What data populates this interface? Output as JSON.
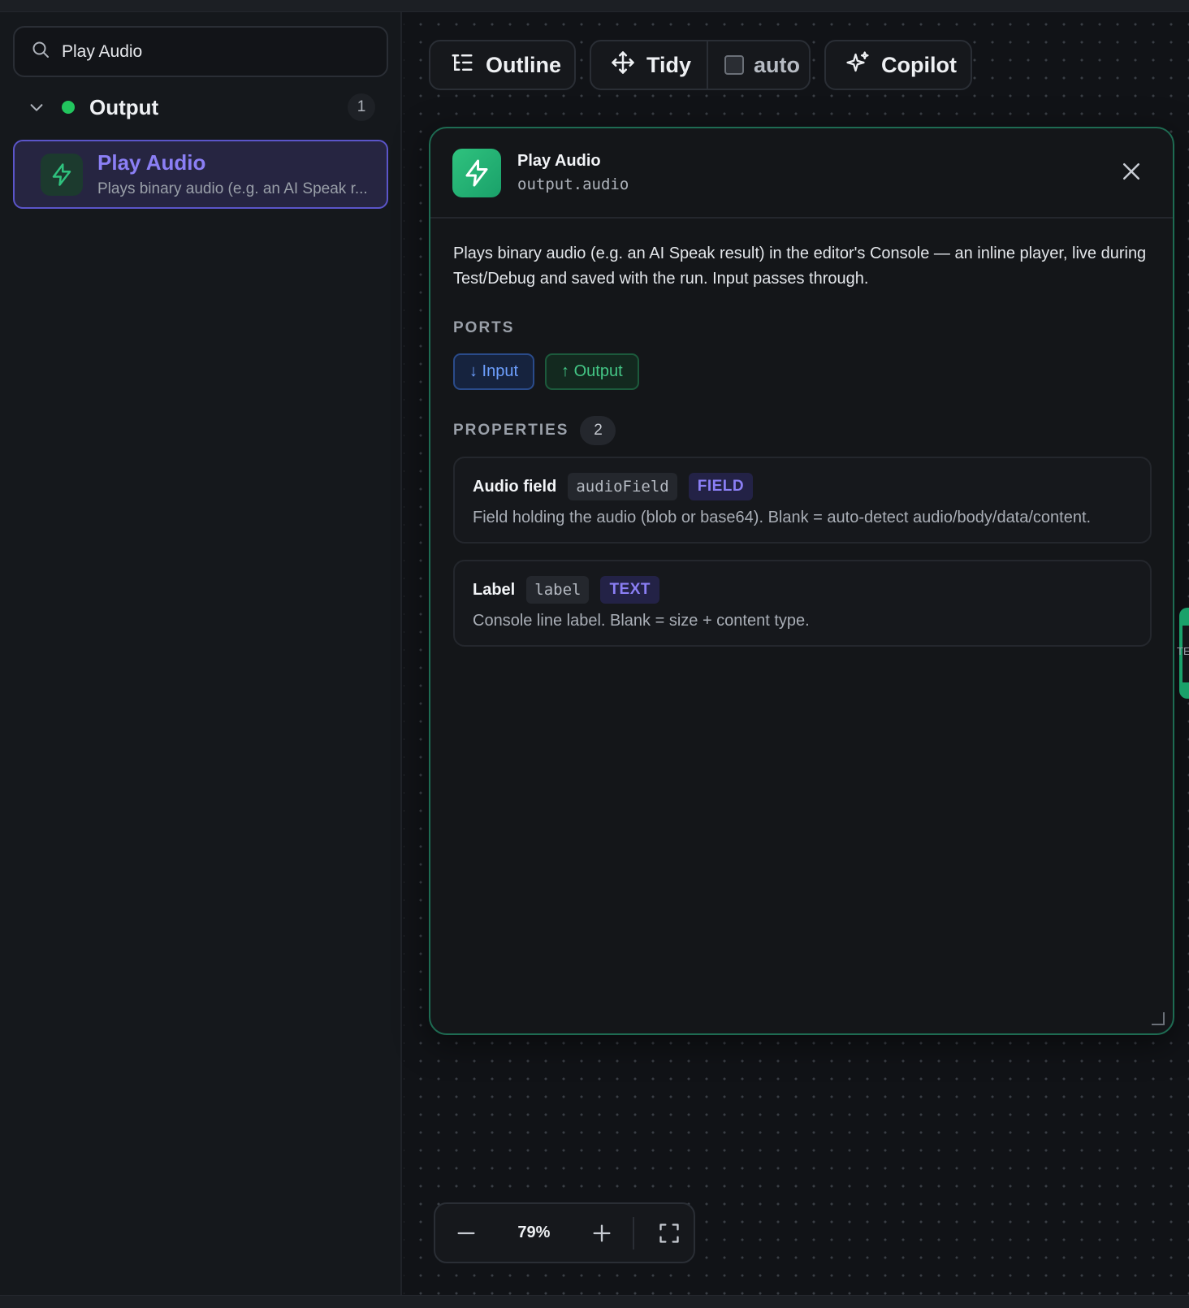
{
  "sidebar": {
    "search": {
      "value": "Play Audio",
      "icon": "search-icon"
    },
    "group": {
      "label": "Output",
      "count": "1",
      "status_color": "#22c55e"
    },
    "node": {
      "title": "Play Audio",
      "description": "Plays binary audio (e.g. an AI Speak r...",
      "icon": "bolt-icon"
    }
  },
  "toolbar": {
    "outline_label": "Outline",
    "tidy_label": "Tidy",
    "auto_label": "auto",
    "auto_checked": false,
    "copilot_label": "Copilot"
  },
  "panel": {
    "title": "Play Audio",
    "subtitle": "output.audio",
    "description": "Plays binary audio (e.g. an AI Speak result) in the editor's Console — an inline player, live during Test/Debug and saved with the run. Input passes through.",
    "ports_label": "PORTS",
    "ports": {
      "input": "↓ Input",
      "output": "↑ Output"
    },
    "properties_label": "PROPERTIES",
    "properties_count": "2",
    "properties": [
      {
        "name": "Audio field",
        "key": "audioField",
        "type": "FIELD",
        "description": "Field holding the audio (blob or base64). Blank = auto-detect audio/body/data/content."
      },
      {
        "name": "Label",
        "key": "label",
        "type": "TEXT",
        "description": "Console line label. Blank = size + content type."
      }
    ],
    "accent_color": "#1aa16a"
  },
  "zoom": {
    "level": "79%"
  },
  "edge_peek_text": "TE"
}
